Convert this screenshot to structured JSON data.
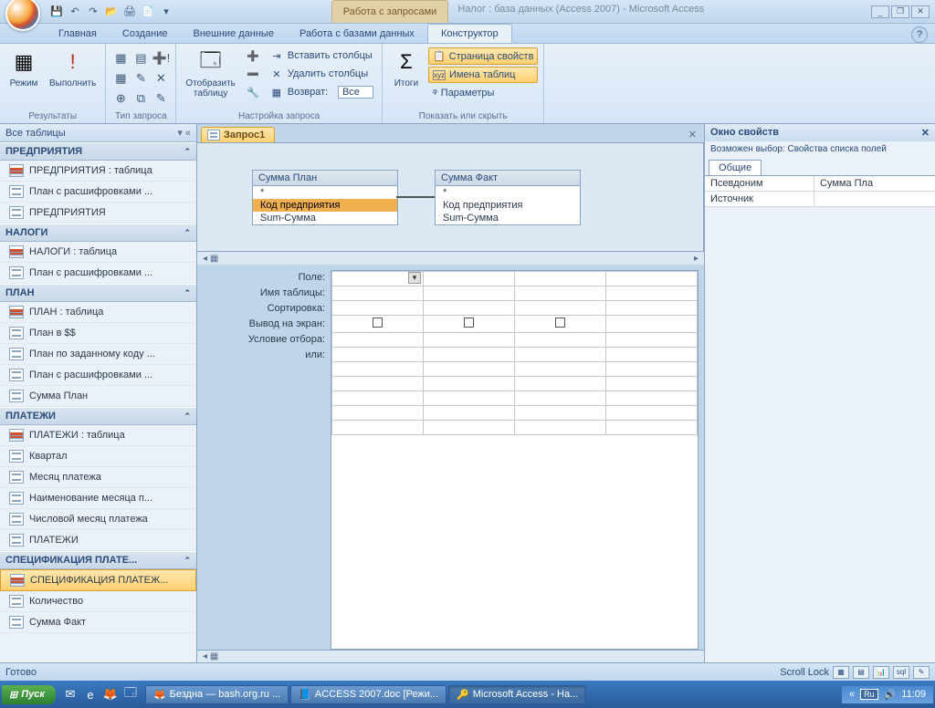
{
  "title": {
    "context_tab": "Работа с запросами",
    "app_title": "Налог : база данных (Access 2007) - Microsoft Access"
  },
  "ribbon_tabs": [
    "Главная",
    "Создание",
    "Внешние данные",
    "Работа с базами данных",
    "Конструктор"
  ],
  "ribbon": {
    "g1": {
      "mode": "Режим",
      "run": "Выполнить",
      "label": "Результаты"
    },
    "g2": {
      "label": "Тип запроса"
    },
    "g3": {
      "show_table": "Отобразить\nтаблицу",
      "insert_cols": "Вставить столбцы",
      "delete_cols": "Удалить столбцы",
      "return": "Возврат:",
      "return_val": "Все",
      "label": "Настройка запроса"
    },
    "g4": {
      "totals": "Итоги",
      "label": "Показать или скрыть",
      "prop_sheet": "Страница свойств",
      "table_names": "Имена таблиц",
      "params": "Параметры"
    }
  },
  "nav": {
    "header": "Все таблицы",
    "groups": [
      {
        "name": "ПРЕДПРИЯТИЯ",
        "items": [
          {
            "t": "table",
            "label": "ПРЕДПРИЯТИЯ : таблица"
          },
          {
            "t": "query",
            "label": "План с расшифровками ..."
          },
          {
            "t": "query",
            "label": "ПРЕДПРИЯТИЯ"
          }
        ]
      },
      {
        "name": "НАЛОГИ",
        "items": [
          {
            "t": "table",
            "label": "НАЛОГИ : таблица"
          },
          {
            "t": "query",
            "label": "План с расшифровками ..."
          }
        ]
      },
      {
        "name": "ПЛАН",
        "items": [
          {
            "t": "table",
            "label": "ПЛАН : таблица"
          },
          {
            "t": "query",
            "label": "План в $$"
          },
          {
            "t": "query",
            "label": "План по заданному коду ..."
          },
          {
            "t": "query",
            "label": "План с расшифровками ..."
          },
          {
            "t": "query",
            "label": "Сумма План"
          }
        ]
      },
      {
        "name": "ПЛАТЕЖИ",
        "items": [
          {
            "t": "table",
            "label": "ПЛАТЕЖИ : таблица"
          },
          {
            "t": "query",
            "label": "Квартал"
          },
          {
            "t": "query",
            "label": "Месяц платежа"
          },
          {
            "t": "query",
            "label": "Наименование месяца п..."
          },
          {
            "t": "query",
            "label": "Числовой месяц платежа"
          },
          {
            "t": "query",
            "label": "ПЛАТЕЖИ"
          }
        ]
      },
      {
        "name": "СПЕЦИФИКАЦИЯ ПЛАТЕ...",
        "items": [
          {
            "t": "table",
            "label": "СПЕЦИФИКАЦИЯ ПЛАТЕЖ...",
            "sel": true
          },
          {
            "t": "query",
            "label": "Количество"
          },
          {
            "t": "query",
            "label": "Сумма Факт"
          }
        ]
      }
    ]
  },
  "doc_tab": "Запрос1",
  "design_tables": [
    {
      "title": "Сумма План",
      "rows": [
        "*",
        "Код предприятия",
        "Sum-Сумма"
      ],
      "sel": 1
    },
    {
      "title": "Сумма Факт",
      "rows": [
        "*",
        "Код предприятия",
        "Sum-Сумма"
      ]
    }
  ],
  "grid_labels": [
    "Поле:",
    "Имя таблицы:",
    "Сортировка:",
    "Вывод на экран:",
    "Условие отбора:",
    "или:"
  ],
  "prop": {
    "title": "Окно свойств",
    "subtitle": "Возможен выбор:  Свойства списка полей",
    "tab": "Общие",
    "rows": [
      {
        "k": "Псевдоним",
        "v": "Сумма Пла"
      },
      {
        "k": "Источник",
        "v": ""
      }
    ]
  },
  "status": {
    "ready": "Готово",
    "scroll": "Scroll Lock"
  },
  "taskbar": {
    "start": "Пуск",
    "tasks": [
      {
        "icon": "🦊",
        "label": "Бездна — bash.org.ru ..."
      },
      {
        "icon": "📘",
        "label": "ACCESS 2007.doc [Режи..."
      },
      {
        "icon": "🔑",
        "label": "Microsoft Access - На...",
        "active": true
      }
    ],
    "lang": "Ru",
    "time": "11:09"
  }
}
